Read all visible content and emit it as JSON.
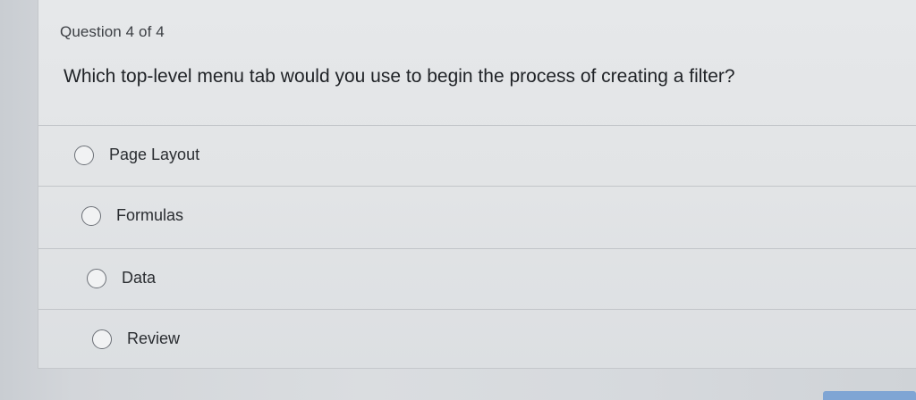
{
  "question": {
    "number_label": "Question 4 of 4",
    "text": "Which top-level menu tab would you use to begin the process of creating a filter?"
  },
  "options": [
    {
      "label": "Page Layout"
    },
    {
      "label": "Formulas"
    },
    {
      "label": "Data"
    },
    {
      "label": "Review"
    }
  ],
  "colors": {
    "card_background": "#e4e6e8",
    "text": "#1f2226",
    "divider": "#c2c5c9",
    "radio_border": "#6c7077"
  }
}
